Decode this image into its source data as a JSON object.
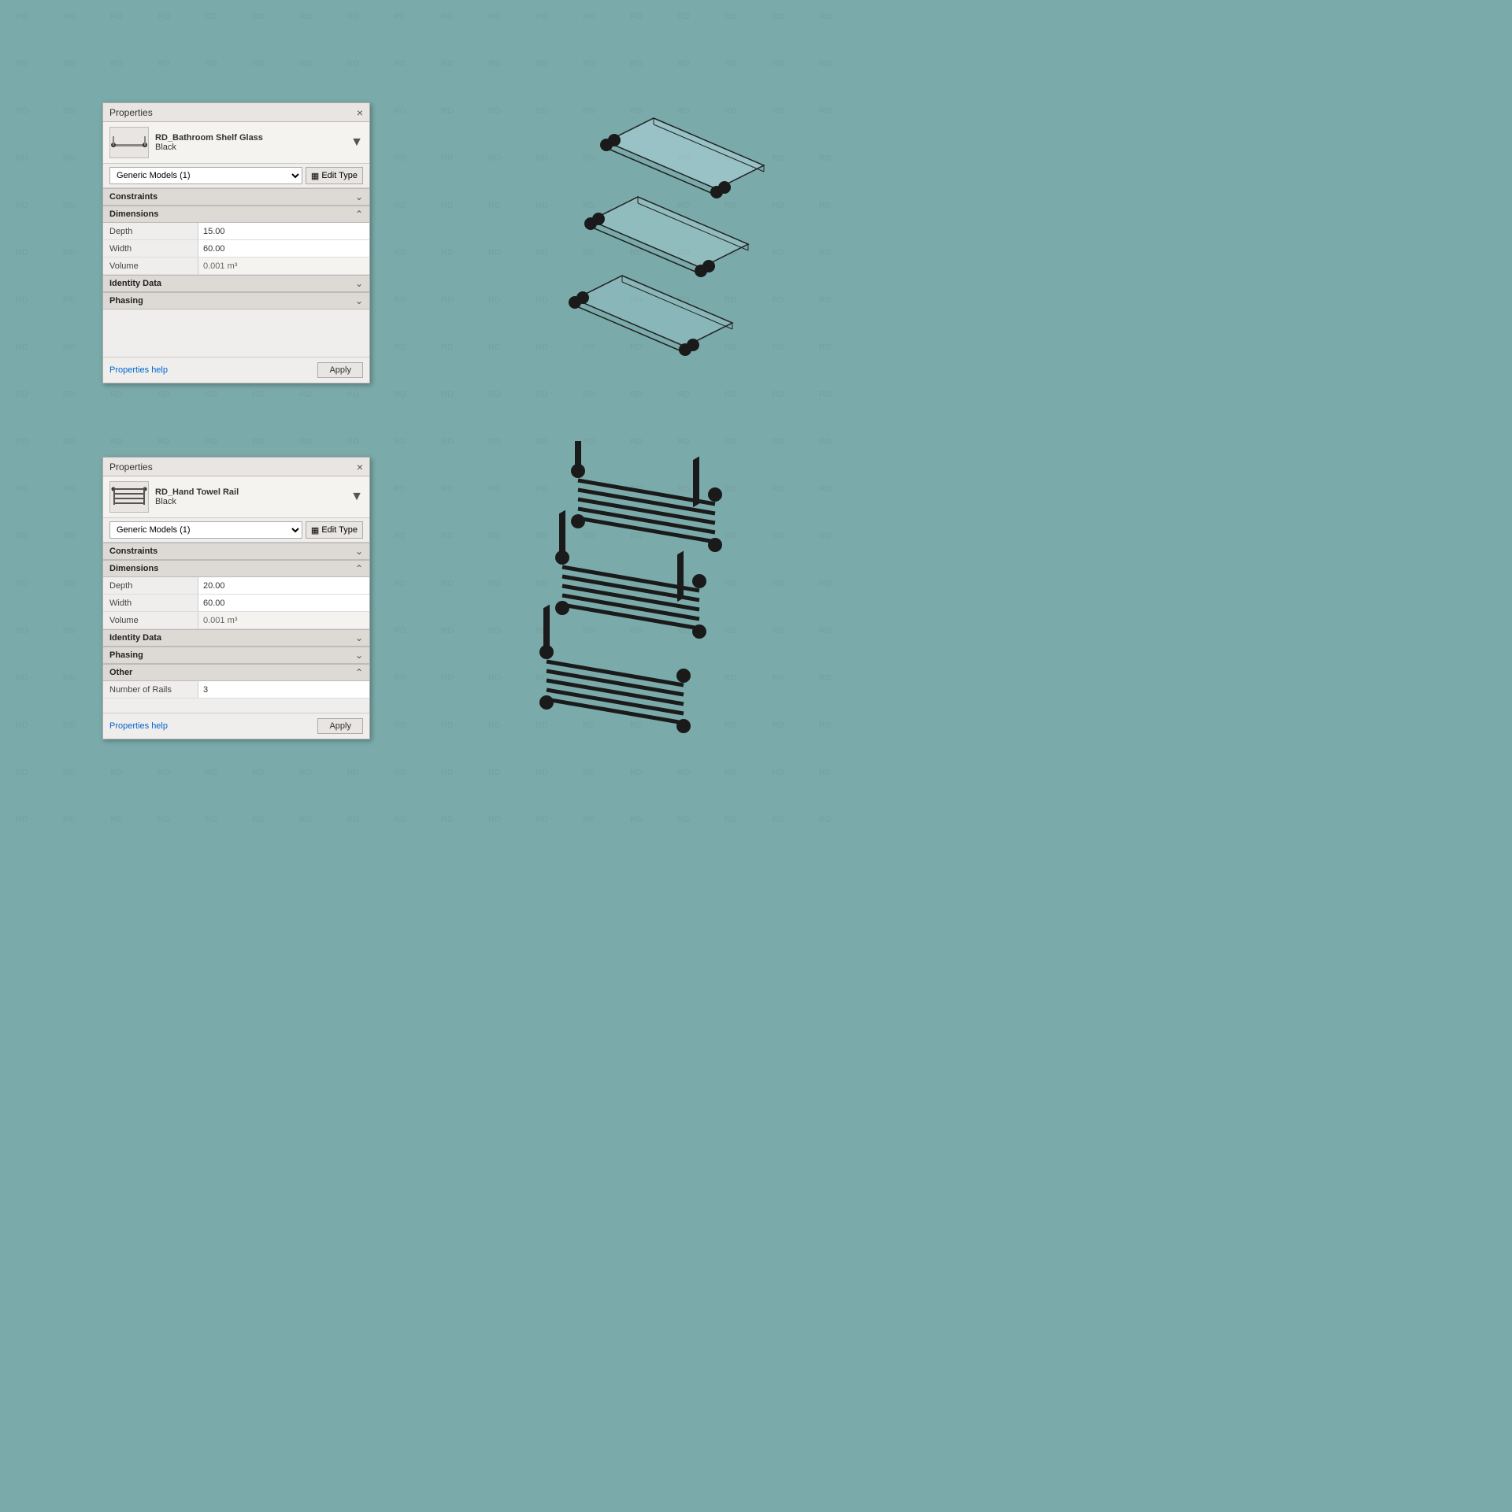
{
  "watermark": {
    "text": "RD",
    "color": "rgba(100,145,143,0.5)"
  },
  "panel_top": {
    "title": "Properties",
    "close_label": "×",
    "object_name": "RD_Bathroom Shelf Glass",
    "object_type": "Black",
    "dropdown_value": "Generic Models (1)",
    "edit_type_label": "Edit Type",
    "sections": {
      "constraints": "Constraints",
      "dimensions": "Dimensions",
      "identity_data": "Identity Data",
      "phasing": "Phasing"
    },
    "properties": {
      "depth_label": "Depth",
      "depth_value": "15.00",
      "width_label": "Width",
      "width_value": "60.00",
      "volume_label": "Volume",
      "volume_value": "0.001 m³"
    },
    "footer": {
      "help_link": "Properties help",
      "apply_btn": "Apply"
    }
  },
  "panel_bottom": {
    "title": "Properties",
    "close_label": "×",
    "object_name": "RD_Hand Towel Rail",
    "object_type": "Black",
    "dropdown_value": "Generic Models (1)",
    "edit_type_label": "Edit Type",
    "sections": {
      "constraints": "Constraints",
      "dimensions": "Dimensions",
      "identity_data": "Identity Data",
      "phasing": "Phasing",
      "other": "Other"
    },
    "properties": {
      "depth_label": "Depth",
      "depth_value": "20.00",
      "width_label": "Width",
      "width_value": "60.00",
      "volume_label": "Volume",
      "volume_value": "0.001 m³",
      "rails_label": "Number of Rails",
      "rails_value": "3"
    },
    "footer": {
      "help_link": "Properties help",
      "apply_btn": "Apply"
    }
  }
}
